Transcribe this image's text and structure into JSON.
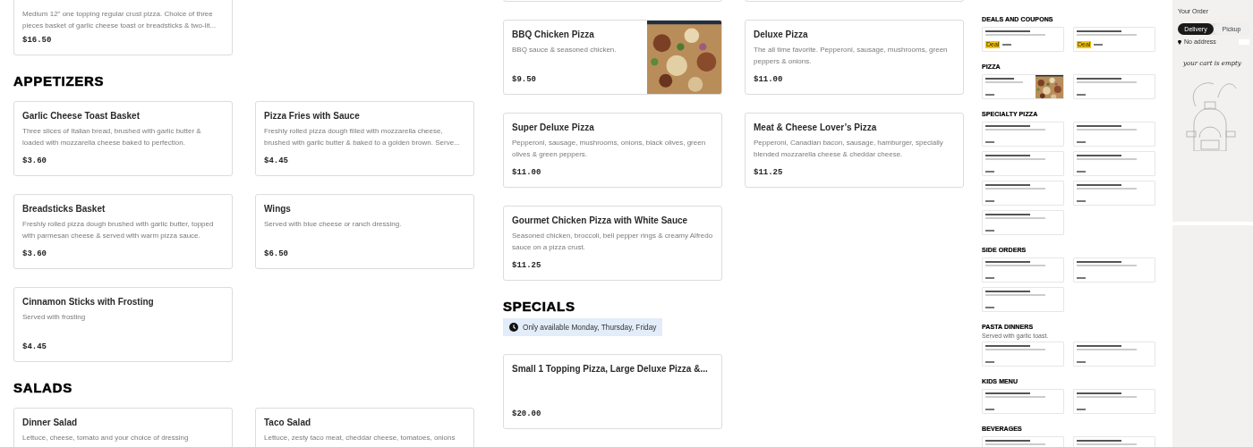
{
  "menu_columns": [
    {
      "blocks": [
        {
          "kind": "cards",
          "cards": [
            {
              "kind": "plain",
              "description": "Medium 12\" one topping regular crust pizza. Choice of three pieces basket of garlic cheese toast or breadsticks & two-lit...",
              "price": "$16.50"
            }
          ]
        },
        {
          "kind": "heading",
          "text": "APPETIZERS"
        },
        {
          "kind": "cards",
          "cards": [
            {
              "kind": "plain",
              "title": "Garlic Cheese Toast Basket",
              "description": "Three slices of Italian bread, brushed with garlic butter & loaded with mozzarella cheese baked to perfection.",
              "price": "$3.60"
            },
            {
              "kind": "plain",
              "title": "Pizza Fries with Sauce",
              "description": "Freshly rolled pizza dough filled with mozzarella cheese, brushed with garlic butter & baked to a golden brown. Serve...",
              "price": "$4.45"
            }
          ]
        },
        {
          "kind": "cards",
          "cards": [
            {
              "kind": "plain",
              "title": "Breadsticks Basket",
              "description": "Freshly rolled pizza dough brushed with garlic butter, topped with parmesan cheese & served with warm pizza sauce.",
              "price": "$3.60"
            },
            {
              "kind": "plain",
              "title": "Wings",
              "description": "Served with blue cheese or ranch dressing.",
              "price": "$6.50"
            }
          ]
        },
        {
          "kind": "cards",
          "cards": [
            {
              "kind": "plain",
              "title": "Cinnamon Sticks with Frosting",
              "description": "Served with frosting",
              "price": "$4.45"
            }
          ]
        },
        {
          "kind": "heading",
          "text": "SALADS"
        },
        {
          "kind": "cards",
          "cards": [
            {
              "kind": "plain",
              "title": "Dinner Salad",
              "description": "Lettuce, cheese, tomato and your choice of dressing"
            },
            {
              "kind": "plain",
              "title": "Taco Salad",
              "description": "Lettuce, zesty taco meat, cheddar cheese, tomatoes, onions"
            }
          ]
        }
      ]
    },
    {
      "blocks": [
        {
          "kind": "cards",
          "cards": [
            {
              "kind": "plain"
            },
            {
              "kind": "plain"
            }
          ]
        },
        {
          "kind": "cards",
          "cards": [
            {
              "kind": "with_image",
              "title": "BBQ Chicken Pizza",
              "description": "BBQ sauce & seasoned chicken.",
              "price": "$9.50"
            },
            {
              "kind": "plain",
              "title": "Deluxe Pizza",
              "description": "The all time favorite. Pepperoni, sausage, mushrooms, green peppers & onions.",
              "price": "$11.00"
            }
          ]
        },
        {
          "kind": "cards",
          "cards": [
            {
              "kind": "plain",
              "title": "Super Deluxe Pizza",
              "description": "Pepperoni, sausage, mushrooms, onions, black olives, green olives & green peppers.",
              "price": "$11.00"
            },
            {
              "kind": "plain",
              "title": "Meat & Cheese Lover’s Pizza",
              "description": "Pepperoni, Canadian bacon, sausage, hamburger, specially blended mozzarella cheese & cheddar cheese.",
              "price": "$11.25"
            }
          ]
        },
        {
          "kind": "cards",
          "cards": [
            {
              "kind": "plain",
              "title": "Gourmet Chicken Pizza with White Sauce",
              "description": "Seasoned chicken, broccoli, bell pepper rings & creamy Alfredo sauce on a pizza crust.",
              "price": "$11.25"
            }
          ]
        },
        {
          "kind": "heading",
          "text": "SPECIALS"
        },
        {
          "kind": "notice",
          "text": "Only available Monday, Thursday, Friday"
        },
        {
          "kind": "cards",
          "cards": [
            {
              "kind": "plain",
              "title": "Small 1 Topping Pizza, Large Deluxe Pizza &...",
              "price": "$20.00"
            }
          ]
        }
      ]
    }
  ],
  "page_preview": {
    "sections": [
      {
        "heading": "DEALS AND COUPONS",
        "cards": [
          {
            "kind": "deal",
            "badge": "Deal"
          },
          {
            "kind": "deal",
            "badge": "Deal"
          }
        ]
      },
      {
        "heading": "PIZZA",
        "cards": [
          {
            "kind": "with_image"
          },
          {
            "kind": "plain"
          }
        ]
      },
      {
        "heading": "SPECIALTY PIZZA",
        "cards": [
          {
            "kind": "plain"
          },
          {
            "kind": "plain"
          },
          {
            "kind": "plain"
          },
          {
            "kind": "plain"
          },
          {
            "kind": "plain"
          },
          {
            "kind": "plain"
          },
          {
            "kind": "plain"
          }
        ]
      },
      {
        "heading": "SIDE ORDERS",
        "cards": [
          {
            "kind": "plain"
          },
          {
            "kind": "plain"
          },
          {
            "kind": "plain"
          }
        ]
      },
      {
        "heading": "PASTA DINNERS",
        "note": "Served with garlic toast.",
        "cards": [
          {
            "kind": "plain"
          },
          {
            "kind": "plain"
          }
        ]
      },
      {
        "heading": "KIDS MENU",
        "cards": [
          {
            "kind": "plain"
          },
          {
            "kind": "plain"
          }
        ]
      },
      {
        "heading": "BEVERAGES",
        "cards": [
          {
            "kind": "plain"
          },
          {
            "kind": "plain"
          }
        ]
      }
    ],
    "cart": {
      "title": "Your Order",
      "modes": [
        {
          "label": "Delivery",
          "selected": true
        },
        {
          "label": "Pickup",
          "selected": false
        }
      ],
      "address": "No address",
      "empty_message": "your cart is empty"
    }
  }
}
